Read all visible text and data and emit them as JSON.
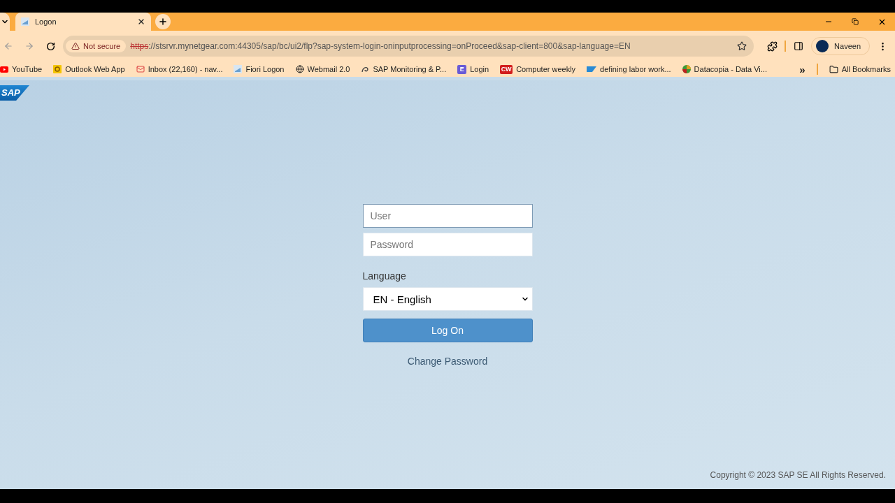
{
  "browser": {
    "tabs": [
      {
        "title": "Logon",
        "selected": true
      }
    ],
    "address": {
      "security": "Not secure",
      "scheme": "https",
      "rest": "://stsrvr.mynetgear.com:44305/sap/bc/ui2/flp?sap-system-login-oninputprocessing=onProceed&sap-client=800&sap-language=EN"
    },
    "profile": {
      "name": "Naveen"
    },
    "bookmarks": [
      {
        "label": "YouTube",
        "kind": "youtube"
      },
      {
        "label": "Outlook Web App",
        "kind": "outlook"
      },
      {
        "label": "Inbox (22,160) - nav...",
        "kind": "mail"
      },
      {
        "label": "Fiori Logon",
        "kind": "page"
      },
      {
        "label": "Webmail 2.0",
        "kind": "globe"
      },
      {
        "label": "SAP Monitoring & P...",
        "kind": "swirl"
      },
      {
        "label": "Login",
        "kind": "letter",
        "badge": "E"
      },
      {
        "label": "Computer weekly",
        "kind": "cw",
        "badge": "CW"
      },
      {
        "label": "defining labor work...",
        "kind": "sap"
      },
      {
        "label": "Datacopia - Data Vi...",
        "kind": "circle"
      }
    ],
    "more": "»",
    "all_bookmarks": "All Bookmarks"
  },
  "page": {
    "logo": "SAP",
    "user": {
      "placeholder": "User"
    },
    "password": {
      "placeholder": "Password"
    },
    "language_label": "Language",
    "language": "EN - English",
    "log_on": "Log On",
    "change_password": "Change Password",
    "copyright": "Copyright © 2023 SAP SE All Rights Reserved."
  }
}
